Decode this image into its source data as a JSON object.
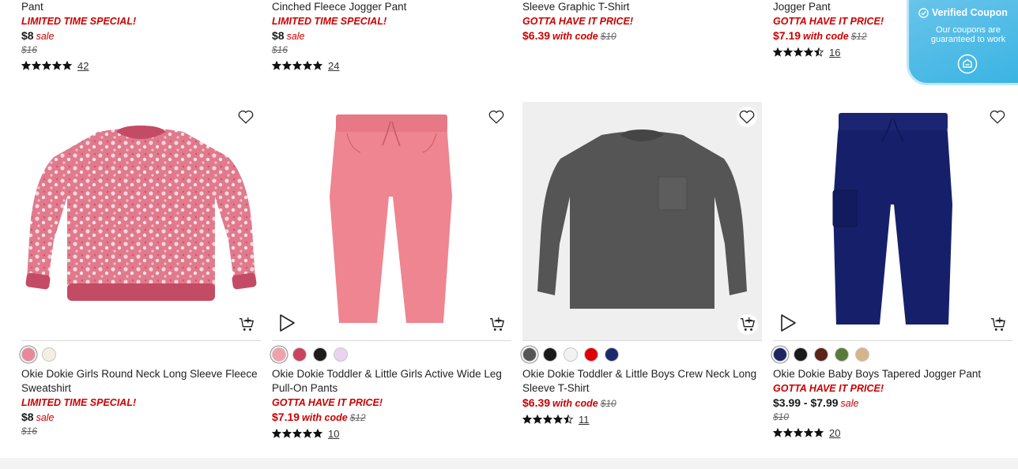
{
  "top_row": [
    {
      "title_tail": "Pant",
      "promo": "LIMITED TIME SPECIAL!",
      "price": "$8",
      "price_suffix": "sale",
      "original": "$16",
      "rating_count": "42",
      "stars": 5
    },
    {
      "title_tail": "Cinched Fleece Jogger Pant",
      "promo": "LIMITED TIME SPECIAL!",
      "price": "$8",
      "price_suffix": "sale",
      "original": "$16",
      "rating_count": "24",
      "stars": 5
    },
    {
      "title_tail": "Sleeve Graphic T-Shirt",
      "promo": "GOTTA HAVE IT PRICE!",
      "price": "$6.39",
      "price_suffix": "with code",
      "original": "$10"
    },
    {
      "title_tail": "Jogger Pant",
      "promo": "GOTTA HAVE IT PRICE!",
      "price": "$7.19",
      "price_suffix": "with code",
      "original": "$12",
      "rating_count": "16",
      "stars": 4.5
    }
  ],
  "products": [
    {
      "name": "Okie Dokie Girls Round Neck Long Sleeve Fleece Sweatshirt",
      "promo": "LIMITED TIME SPECIAL!",
      "price": "$8",
      "price_suffix": "sale",
      "original": "$16",
      "swatches": [
        "#e8889a",
        "#f4efe2"
      ]
    },
    {
      "name": "Okie Dokie Toddler & Little Girls Active Wide Leg Pull-On Pants",
      "promo": "GOTTA HAVE IT PRICE!",
      "price": "$7.19",
      "price_suffix": "with code",
      "original": "$12",
      "rating_count": "10",
      "stars": 5,
      "swatches": [
        "#f4a0aa",
        "#c8445e",
        "#1c1c1c",
        "#e8d4f0"
      ]
    },
    {
      "name": "Okie Dokie Toddler & Little Boys Crew Neck Long Sleeve T-Shirt",
      "price": "$6.39",
      "price_suffix": "with code",
      "original": "$10",
      "rating_count": "11",
      "stars": 4.5,
      "swatches": [
        "#555555",
        "#1a1a1a",
        "#f2f2f2",
        "#e00000",
        "#1c2a6b"
      ]
    },
    {
      "name": "Okie Dokie Baby Boys Tapered Jogger Pant",
      "promo": "GOTTA HAVE IT PRICE!",
      "price": "$3.99 - $7.99",
      "price_suffix": "sale",
      "original": "$10",
      "rating_count": "20",
      "stars": 5,
      "swatches": [
        "#1c2660",
        "#1a1a1a",
        "#5a2418",
        "#5a7a3a",
        "#d6b48a"
      ]
    }
  ],
  "coupon": {
    "title": "Verified Coupon",
    "subtitle": "Our coupons are guaranteed to work"
  },
  "colors": {
    "promo_red": "#cc0000",
    "coupon_blue": "#38b3e2"
  }
}
